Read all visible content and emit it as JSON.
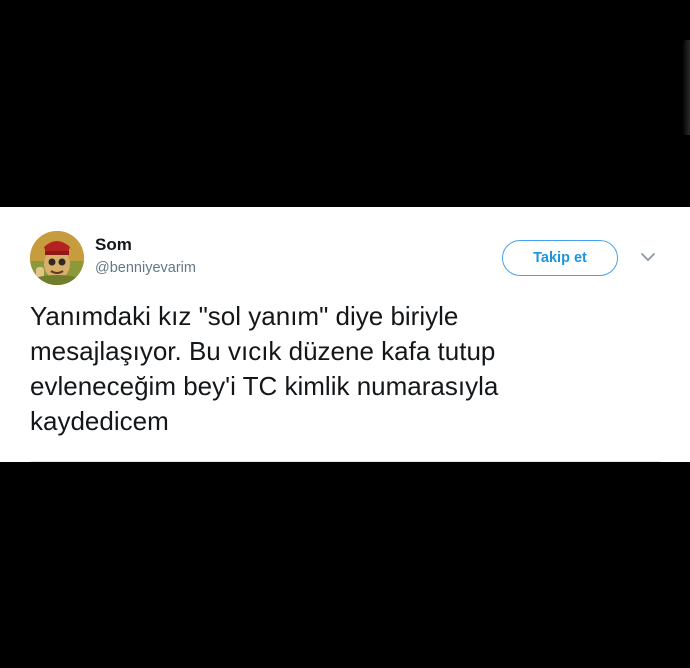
{
  "tweet": {
    "author": {
      "name": "Som",
      "handle": "@benniyevarim"
    },
    "follow_label": "Takip et",
    "text": "Yanımdaki kız \"sol yanım\" diye biriyle\nmesajlaşıyor. Bu vıcık düzene kafa tutup\nevleneceğim bey'i TC kimlik numarasıyla\nkaydedicem"
  },
  "colors": {
    "background": "#000000",
    "card": "#ffffff",
    "accent": "#1b95e0",
    "text": "#14171a",
    "secondary_text": "#657786"
  },
  "icons": {
    "avatar": "profile-avatar",
    "menu": "chevron-down-icon"
  }
}
